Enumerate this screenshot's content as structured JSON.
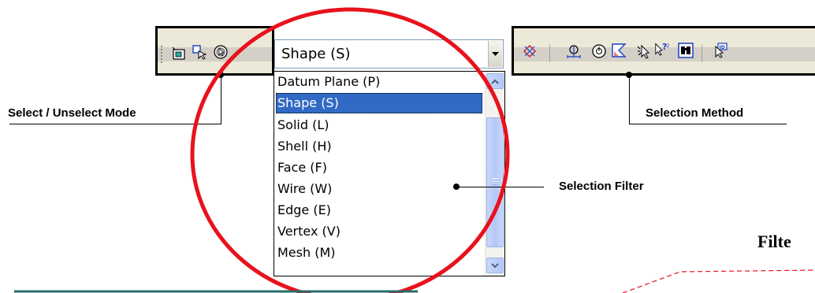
{
  "combo": {
    "value": "Shape (S)"
  },
  "dropdown": {
    "options": [
      "Datum Plane (P)",
      "Shape (S)",
      "Solid (L)",
      "Shell (H)",
      "Face (F)",
      "Wire (W)",
      "Edge (E)",
      "Vertex (V)",
      "Mesh (M)"
    ],
    "selected_index": 1
  },
  "labels": {
    "select_mode": "Select / Unselect Mode",
    "selection_method": "Selection Method",
    "selection_filter": "Selection Filter",
    "filter_partial": "Filte"
  },
  "toolbar_left": {
    "icons": [
      "select-box-icon",
      "select-arrow-icon",
      "unselect-circle-icon"
    ]
  },
  "toolbar_right": {
    "icons": [
      "cross-select-icon",
      "point-select-icon",
      "circle-select-icon",
      "polygon-select-icon",
      "pointer-select-icon",
      "query-select-icon",
      "binoculars-icon",
      "id-select-icon"
    ]
  },
  "colors": {
    "highlight": "#316ac5",
    "toolbar": "#ece9d8",
    "annotation_circle": "#e8121c",
    "dashed_line": "#e8121c"
  }
}
